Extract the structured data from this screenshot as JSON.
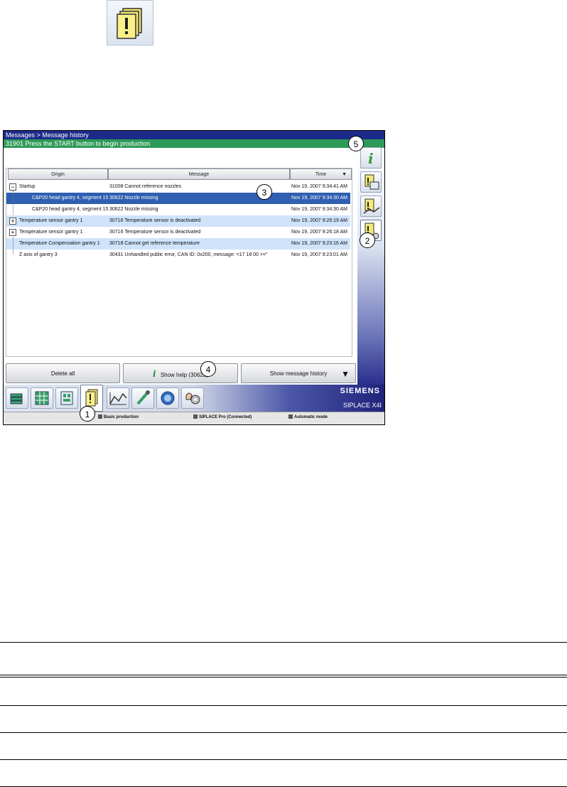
{
  "top_icon": {
    "name": "message-history-icon"
  },
  "screen": {
    "breadcrumb": "Messages > Message history",
    "status_message": "31901 Press the START button to begin production",
    "table": {
      "columns": [
        "Origin",
        "Message",
        "Time"
      ],
      "rows": [
        {
          "origin": "Startup",
          "message": "31008 Cannot reference nozzles",
          "time": "Nov 19, 2007 9:34:41 AM"
        },
        {
          "origin": "C&P20 head gantry 4, segment 15",
          "message": "30622 Nozzle missing",
          "time": "Nov 19, 2007 9:34:30 AM"
        },
        {
          "origin": "C&P20 head gantry 4, segment 15",
          "message": "30622 Nozzle missing",
          "time": "Nov 19, 2007 9:34:30 AM"
        },
        {
          "origin": "Temperature sensor gantry 1",
          "message": "30716 Temperature sensor is deactivated",
          "time": "Nov 19, 2007 9:26:19 AM"
        },
        {
          "origin": "Temperature sensor gantry 1",
          "message": "30716 Temperature sensor is deactivated",
          "time": "Nov 19, 2007 9:26:18 AM"
        },
        {
          "origin": "Temperature Compensation gantry 1",
          "message": "30718 Cannot get reference temperature",
          "time": "Nov 19, 2007 9:23:16 AM"
        },
        {
          "origin": "Z axis of gantry 3",
          "message": "30431 Unhandled public error, CAN ID: 0x200, message: <17 18 00 >=\"",
          "time": "Nov 19, 2007 9:23:01 AM"
        }
      ]
    },
    "buttons": {
      "delete_all": "Delete all",
      "show_help": "Show help (30622)",
      "show_history": "Show message history"
    },
    "brand": "SIEMENS",
    "model": "SIPLACE X4I",
    "statusbar": {
      "production": "Basic production",
      "connection": "SIPLACE Pro (Connected)",
      "mode": "Automatic mode"
    },
    "callouts": [
      "1",
      "2",
      "3",
      "4",
      "5"
    ]
  },
  "colors": {
    "title_bar": "#1c2b8a",
    "status_bar_green": "#2e9a57",
    "selected_row": "#2f5fb0",
    "light_row": "#cfe3fb"
  }
}
